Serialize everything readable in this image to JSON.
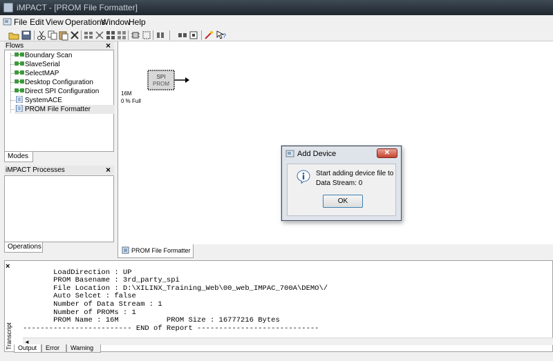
{
  "window": {
    "title": "iMPACT - [PROM File Formatter]"
  },
  "menu": {
    "items": [
      "File",
      "Edit",
      "View",
      "Operations",
      "Window",
      "Help"
    ]
  },
  "toolbar": {
    "icons": [
      "open-icon",
      "save-icon",
      "cut-icon",
      "copy-icon",
      "paste-icon",
      "delete-icon",
      "chain-icon",
      "split-icon",
      "grid-icon",
      "grid2-icon",
      "chip-icon",
      "config-icon",
      "boundary-icon",
      "ram-icon",
      "program-icon",
      "help-icon"
    ]
  },
  "flows": {
    "title": "Flows",
    "items": [
      "Boundary Scan",
      "SlaveSerial",
      "SelectMAP",
      "Desktop Configuration",
      "Direct SPI Configuration",
      "SystemACE",
      "PROM File Formatter"
    ],
    "tab": "Modes"
  },
  "processes": {
    "title": "iMPACT Processes",
    "tab": "Operations"
  },
  "canvas": {
    "chip_line1": "SPI",
    "chip_line2": "PROM",
    "size": "16M",
    "fill": "0 % Full",
    "tab": "PROM File Formatter"
  },
  "dialog": {
    "title": "Add Device",
    "line1": "Start adding device file to",
    "line2": "Data Stream: 0",
    "ok": "OK"
  },
  "transcript": {
    "label": "Transcript",
    "lines": [
      "       LoadDirection : UP",
      "       PROM Basename : 3rd_party_spi",
      "       File Location : D:\\XILINX_Training_Web\\00_web_IMPAC_700A\\DEMO\\/",
      "       Auto Selcet : false",
      "       Number of Data Stream : 1",
      "       Number of PROMs : 1",
      "       PROM Name : 16M           PROM Size : 16777216 Bytes",
      "------------------------- END of Report ----------------------------"
    ],
    "tabs": [
      "Output",
      "Error",
      "Warning"
    ]
  }
}
